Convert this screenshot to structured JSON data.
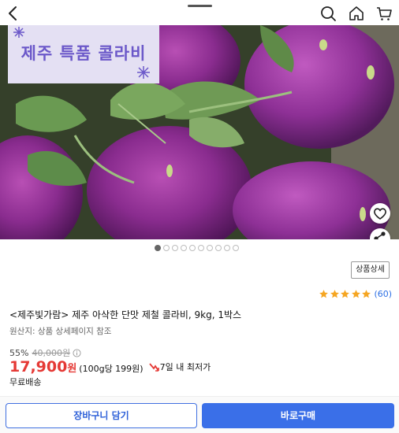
{
  "header": {
    "back_icon": "chevron-left-icon",
    "search_icon": "search-icon",
    "home_icon": "home-icon",
    "cart_icon": "cart-icon"
  },
  "hero": {
    "banner_text": "제주 특품 콜라비",
    "pager": {
      "total": 10,
      "active_index": 0
    },
    "wishlist_icon": "heart-icon",
    "share_icon": "share-icon"
  },
  "product": {
    "detail_button": "상품상세",
    "rating_stars": 5,
    "review_count": "(60)",
    "title": "<제주빛가람> 제주 아삭한 단맛 제철 콜라비, 9kg, 1박스",
    "origin": "원산지: 상품 상세페이지 참조",
    "discount_rate": "55%",
    "original_price": "40,000원",
    "sale_price": "17,900",
    "sale_price_unit": "원",
    "unit_price": "(100g당 199원)",
    "lowest_badge": "7일 내 최저가",
    "shipping": "무료배송"
  },
  "actions": {
    "add_to_cart": "장바구니 담기",
    "buy_now": "바로구매"
  },
  "colors": {
    "accent_blue": "#3a6fe8",
    "price_red": "#e53935",
    "star_gold": "#f5a623",
    "banner_bg": "#e4e0f3",
    "banner_text": "#6b58c9"
  }
}
